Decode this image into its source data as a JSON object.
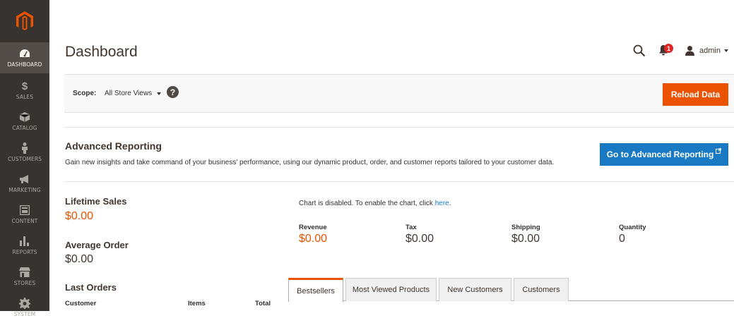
{
  "brand": {
    "accent": "#eb5202",
    "link": "#1979c3",
    "sidebar_bg": "#373330"
  },
  "sidebar": {
    "logo": "magento-logo",
    "items": [
      {
        "label": "DASHBOARD",
        "icon": "dashboard-icon",
        "active": true
      },
      {
        "label": "SALES",
        "icon": "dollar-icon"
      },
      {
        "label": "CATALOG",
        "icon": "cube-icon"
      },
      {
        "label": "CUSTOMERS",
        "icon": "person-icon"
      },
      {
        "label": "MARKETING",
        "icon": "megaphone-icon"
      },
      {
        "label": "CONTENT",
        "icon": "content-icon"
      },
      {
        "label": "REPORTS",
        "icon": "bar-chart-icon"
      },
      {
        "label": "STORES",
        "icon": "store-icon"
      },
      {
        "label": "SYSTEM",
        "icon": "gear-icon"
      }
    ]
  },
  "header": {
    "title": "Dashboard",
    "notification_count": "1",
    "user": "admin"
  },
  "scope": {
    "label": "Scope:",
    "value": "All Store Views",
    "help": "?",
    "reload_label": "Reload Data"
  },
  "advanced_reporting": {
    "title": "Advanced Reporting",
    "description": "Gain new insights and take command of your business' performance, using our dynamic product, order, and customer reports tailored to your customer data.",
    "button_label": "Go to Advanced Reporting"
  },
  "stats": {
    "lifetime_sales_label": "Lifetime Sales",
    "lifetime_sales_value": "$0.00",
    "average_order_label": "Average Order",
    "average_order_value": "$0.00",
    "last_orders_label": "Last Orders"
  },
  "chart": {
    "message": "Chart is disabled. To enable the chart, click ",
    "link": "here",
    "message_end": "."
  },
  "totals": {
    "revenue_label": "Revenue",
    "revenue_value": "$0.00",
    "tax_label": "Tax",
    "tax_value": "$0.00",
    "shipping_label": "Shipping",
    "shipping_value": "$0.00",
    "quantity_label": "Quantity",
    "quantity_value": "0"
  },
  "tabs": [
    {
      "label": "Bestsellers",
      "active": true
    },
    {
      "label": "Most Viewed Products"
    },
    {
      "label": "New Customers"
    },
    {
      "label": "Customers"
    }
  ],
  "last_orders_columns": [
    "Customer",
    "Items",
    "Total"
  ]
}
